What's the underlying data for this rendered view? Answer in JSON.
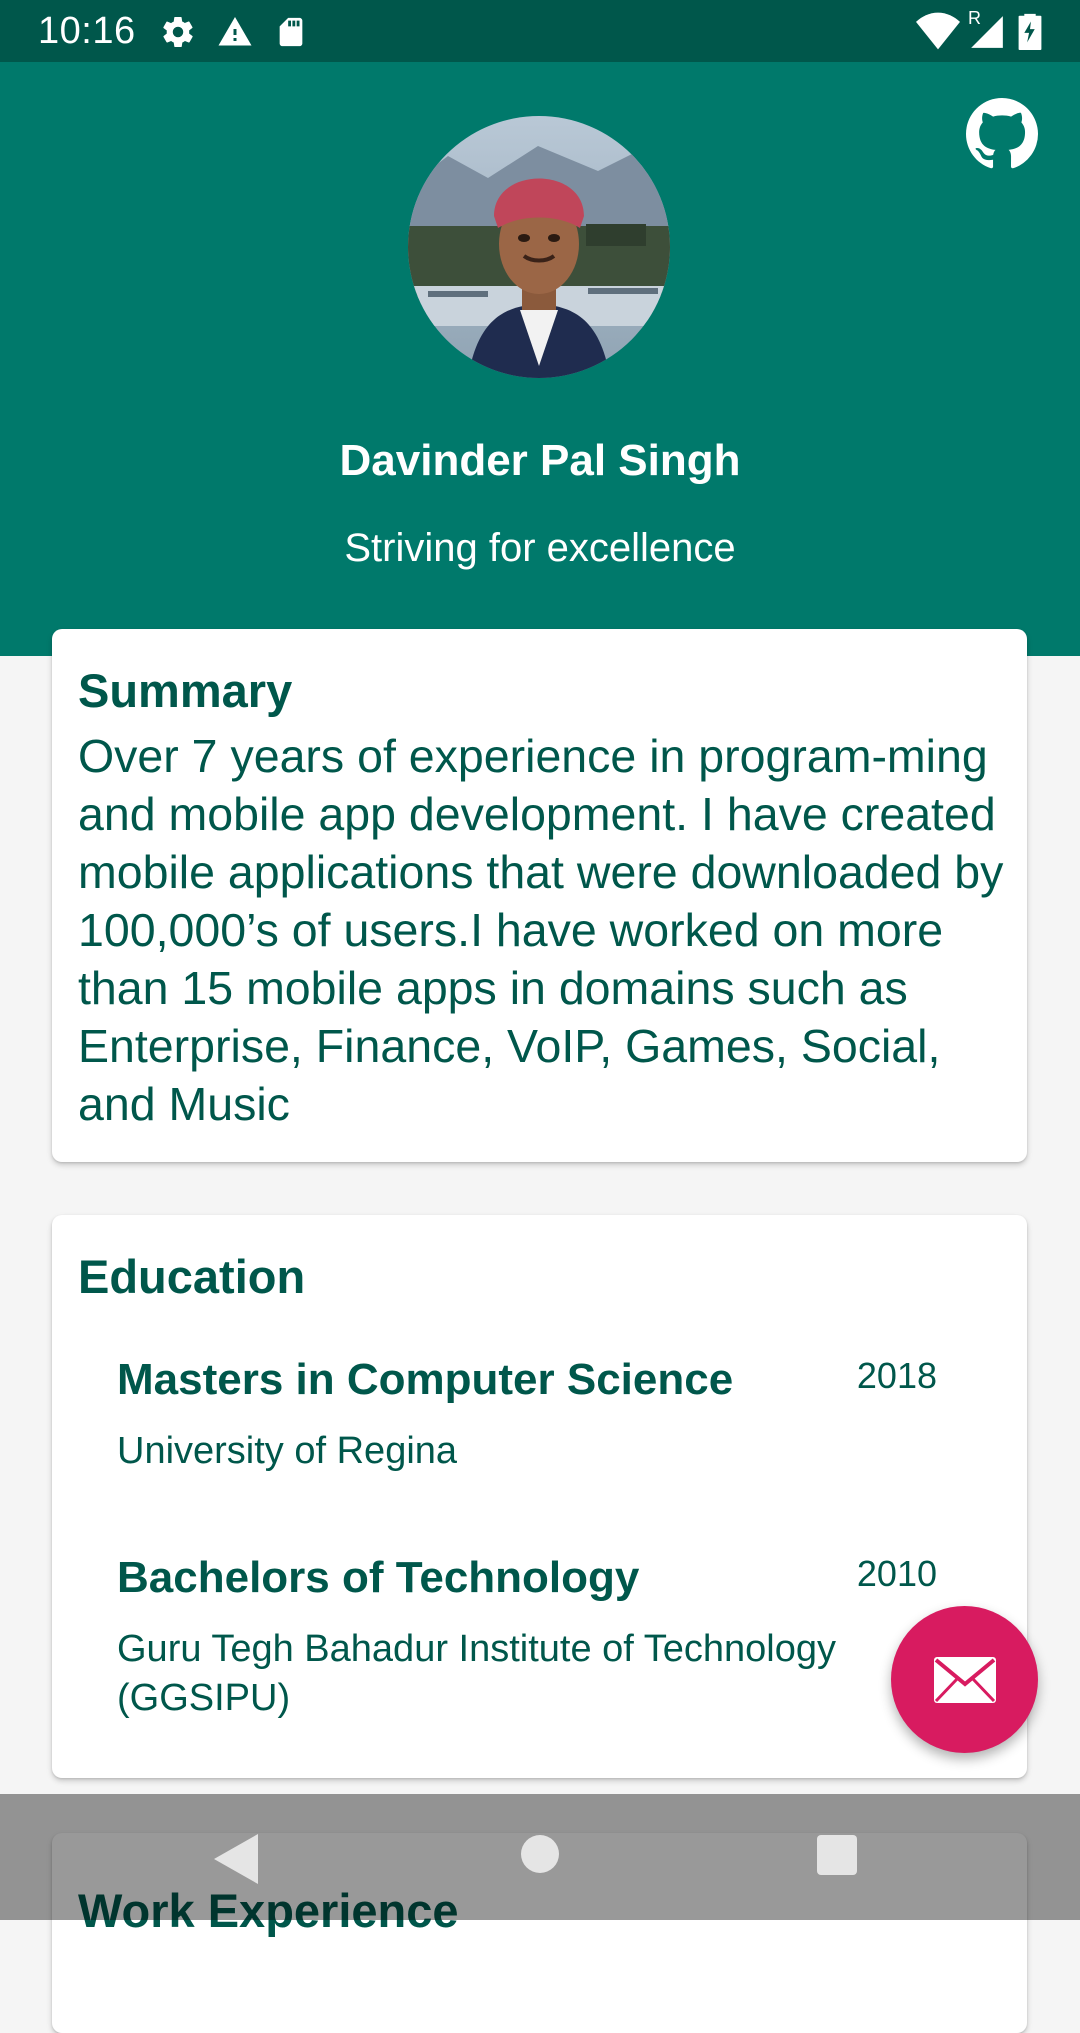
{
  "status_bar": {
    "time": "10:16",
    "left_icons": [
      "settings-icon",
      "alert-icon",
      "sd-card-icon"
    ],
    "right_icons": [
      "wifi-icon",
      "signal-roaming-icon",
      "battery-charging-icon"
    ],
    "roaming_indicator": "R"
  },
  "theme": {
    "primary": "#00796b",
    "primary_dark": "#00574b",
    "accent": "#d81b60",
    "text_primary": "#00574b"
  },
  "profile": {
    "name": "Davinder Pal Singh",
    "tagline": "Striving for excellence",
    "avatar_icon": "profile-photo",
    "github_icon": "github-icon"
  },
  "summary": {
    "title": "Summary",
    "text": "Over 7 years of experience in program-ming and mobile app development. I have created mobile applications that were downloaded by 100,000’s of users.I have worked on more than 15 mobile apps in domains such as Enterprise, Finance, VoIP, Games, Social, and Music"
  },
  "education": {
    "title": "Education",
    "entries": [
      {
        "degree": "Masters in Computer Science",
        "year": "2018",
        "school": "University of Regina"
      },
      {
        "degree": "Bachelors of Technology",
        "year": "2010",
        "school": "Guru Tegh Bahadur Institute of Technology (GGSIPU)"
      }
    ]
  },
  "work": {
    "title": "Work Experience"
  },
  "fab": {
    "icon": "mail-icon"
  },
  "nav_bar": {
    "buttons": [
      "back-icon",
      "home-icon",
      "recents-icon"
    ]
  }
}
